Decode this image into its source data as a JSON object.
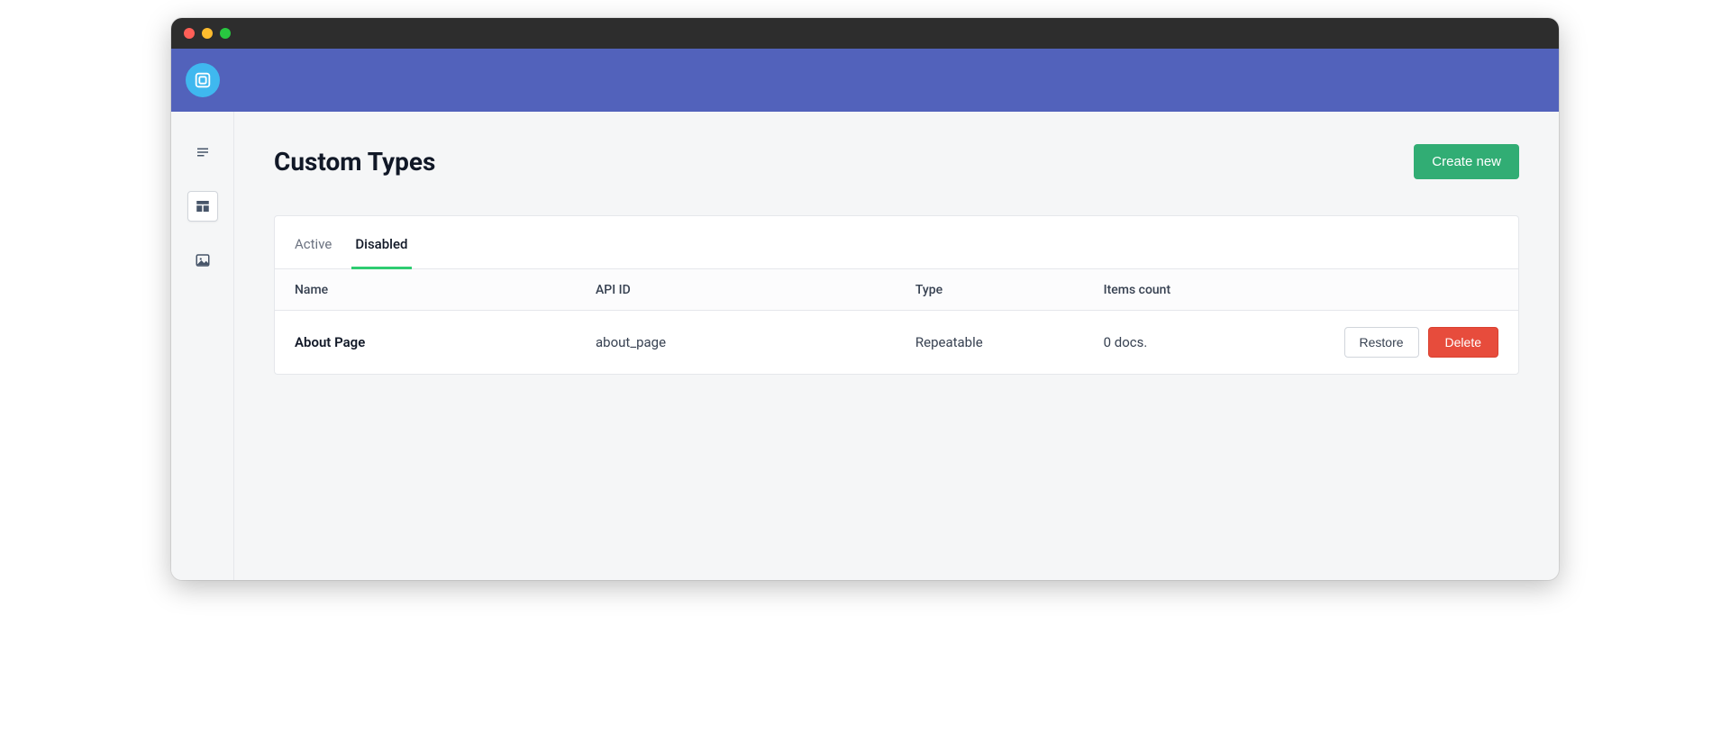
{
  "page": {
    "title": "Custom Types",
    "create_label": "Create new"
  },
  "tabs": {
    "active": "Active",
    "disabled": "Disabled"
  },
  "columns": {
    "name": "Name",
    "api_id": "API ID",
    "type": "Type",
    "items_count": "Items count"
  },
  "rows": [
    {
      "name": "About Page",
      "api_id": "about_page",
      "type": "Repeatable",
      "items_count": "0 docs."
    }
  ],
  "actions": {
    "restore": "Restore",
    "delete": "Delete"
  }
}
